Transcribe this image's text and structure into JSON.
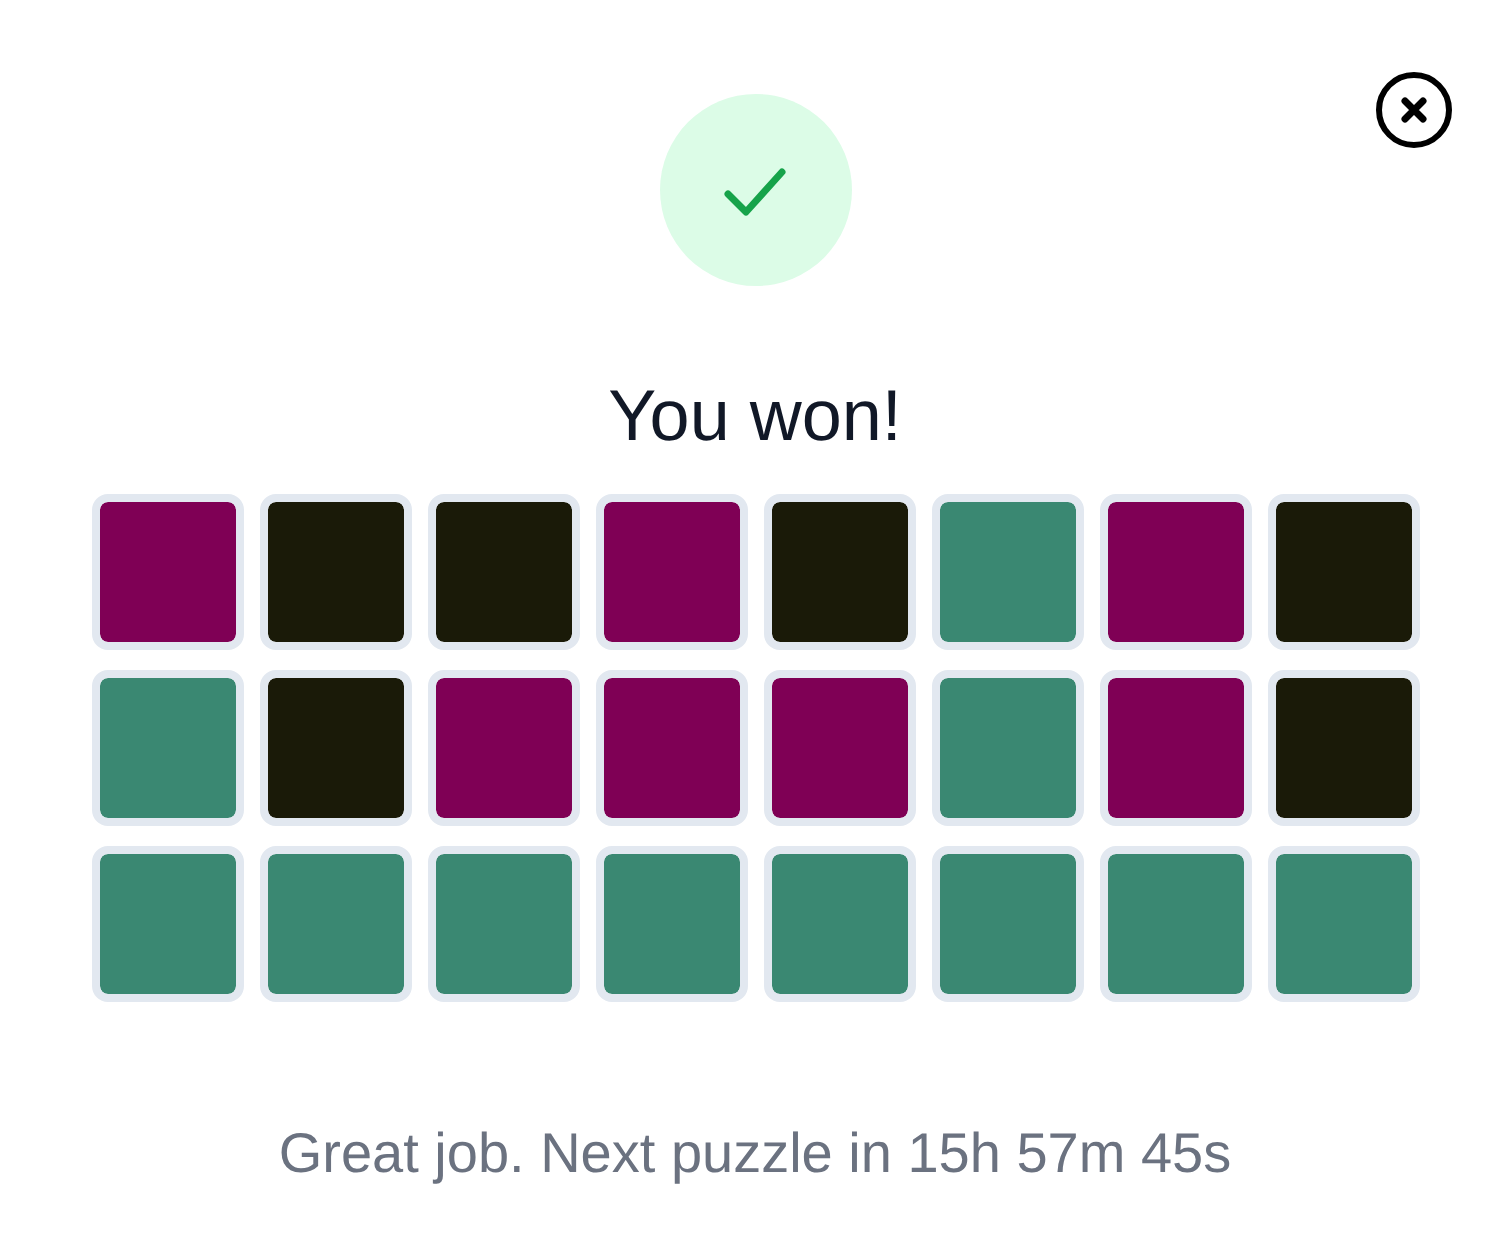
{
  "dialog": {
    "title": "You won!",
    "grid": {
      "rows": [
        {
          "tiles": [
            {
              "color": "#7f0055"
            },
            {
              "color": "#1a1a08"
            },
            {
              "color": "#1a1a08"
            },
            {
              "color": "#7f0055"
            },
            {
              "color": "#1a1a08"
            },
            {
              "color": "#3a8872"
            },
            {
              "color": "#7f0055"
            },
            {
              "color": "#1a1a08"
            }
          ]
        },
        {
          "tiles": [
            {
              "color": "#3a8872"
            },
            {
              "color": "#1a1a08"
            },
            {
              "color": "#7f0055"
            },
            {
              "color": "#7f0055"
            },
            {
              "color": "#7f0055"
            },
            {
              "color": "#3a8872"
            },
            {
              "color": "#7f0055"
            },
            {
              "color": "#1a1a08"
            }
          ]
        },
        {
          "tiles": [
            {
              "color": "#3a8872"
            },
            {
              "color": "#3a8872"
            },
            {
              "color": "#3a8872"
            },
            {
              "color": "#3a8872"
            },
            {
              "color": "#3a8872"
            },
            {
              "color": "#3a8872"
            },
            {
              "color": "#3a8872"
            },
            {
              "color": "#3a8872"
            }
          ]
        }
      ]
    },
    "footer": "Great job. Next puzzle in 15h 57m 45s"
  }
}
